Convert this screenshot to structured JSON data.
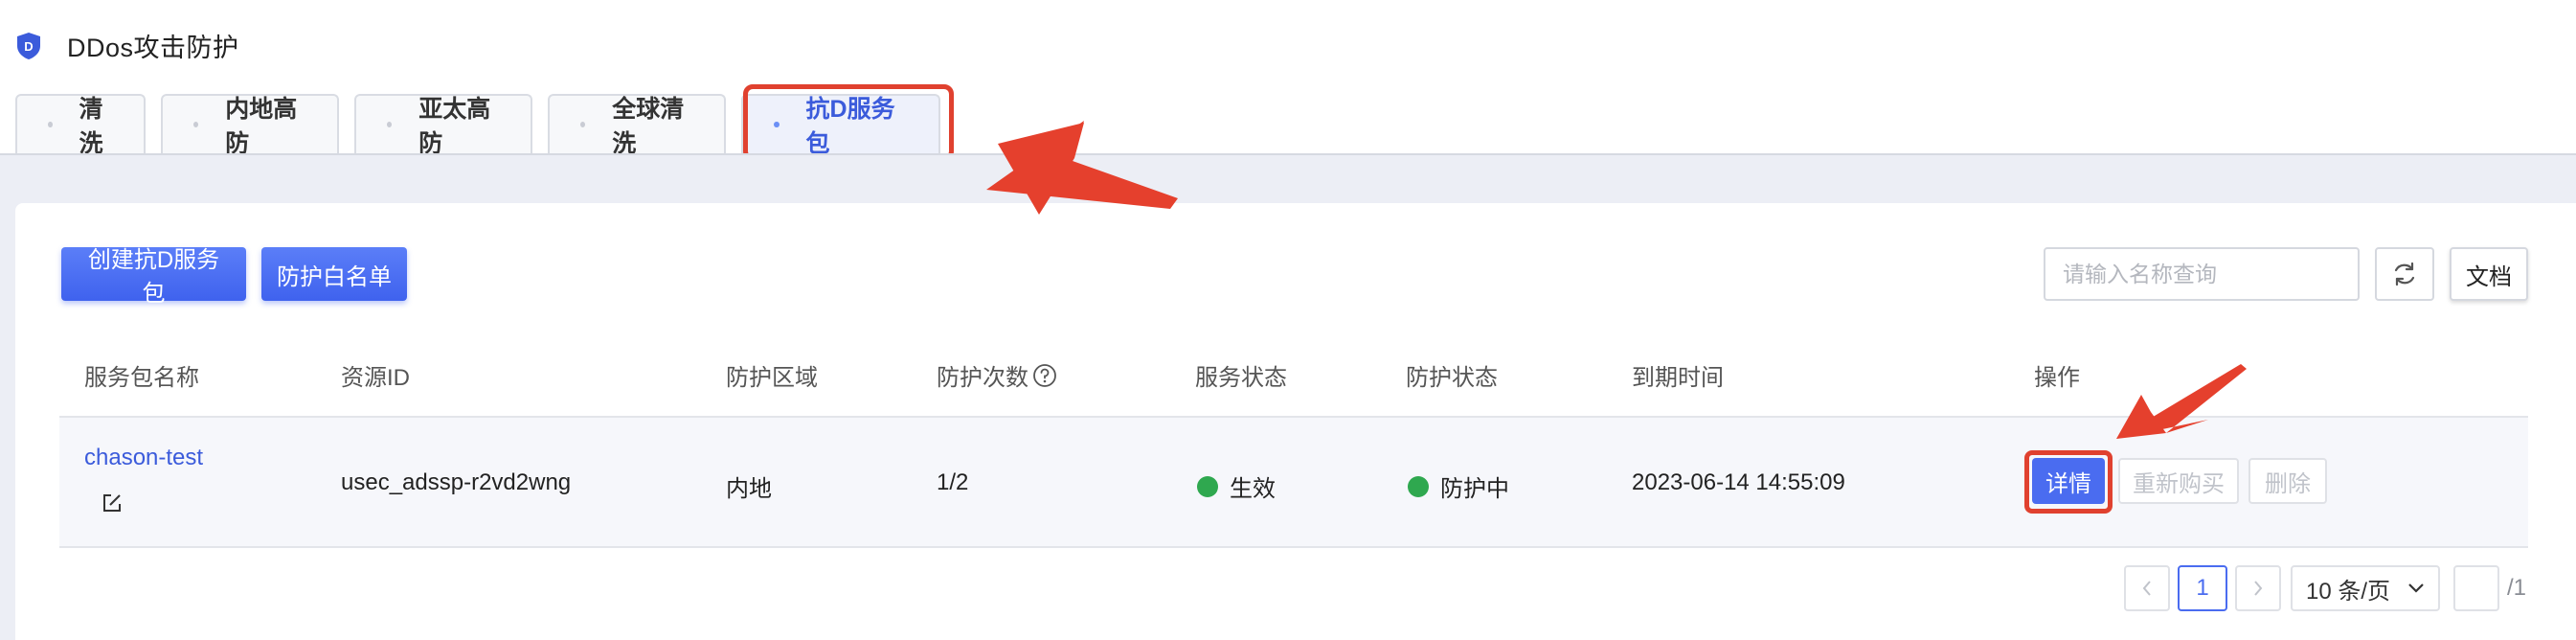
{
  "header": {
    "title": "DDos攻击防护",
    "logo_letter": "D",
    "logo_color": "#3b5bdb"
  },
  "tabs": [
    {
      "label": "清洗",
      "active": false
    },
    {
      "label": "内地高防",
      "active": false
    },
    {
      "label": "亚太高防",
      "active": false
    },
    {
      "label": "全球清洗",
      "active": false
    },
    {
      "label": "抗D服务包",
      "active": true
    }
  ],
  "toolbar": {
    "create_label": "创建抗D服务包",
    "whitelist_label": "防护白名单",
    "search_placeholder": "请输入名称查询",
    "refresh_icon": "refresh-icon",
    "docs_label": "文档"
  },
  "table": {
    "columns": [
      "服务包名称",
      "资源ID",
      "防护区域",
      "防护次数",
      "服务状态",
      "防护状态",
      "到期时间",
      "操作"
    ],
    "rows": [
      {
        "name": "chason-test",
        "resource_id": "usec_adssp-r2vd2wng",
        "region": "内地",
        "count": "1/2",
        "service_status": "生效",
        "protect_status": "防护中",
        "expire": "2023-06-14 14:55:09",
        "actions": {
          "detail": "详情",
          "renew": "重新购买",
          "delete": "删除"
        }
      }
    ]
  },
  "pagination": {
    "current_page": "1",
    "page_size": "10 条/页",
    "total_pages": "/1",
    "jump_value": ""
  },
  "colors": {
    "accent": "#4a6cf0",
    "annotation": "#e0412f",
    "status_green": "#2fa84f"
  }
}
